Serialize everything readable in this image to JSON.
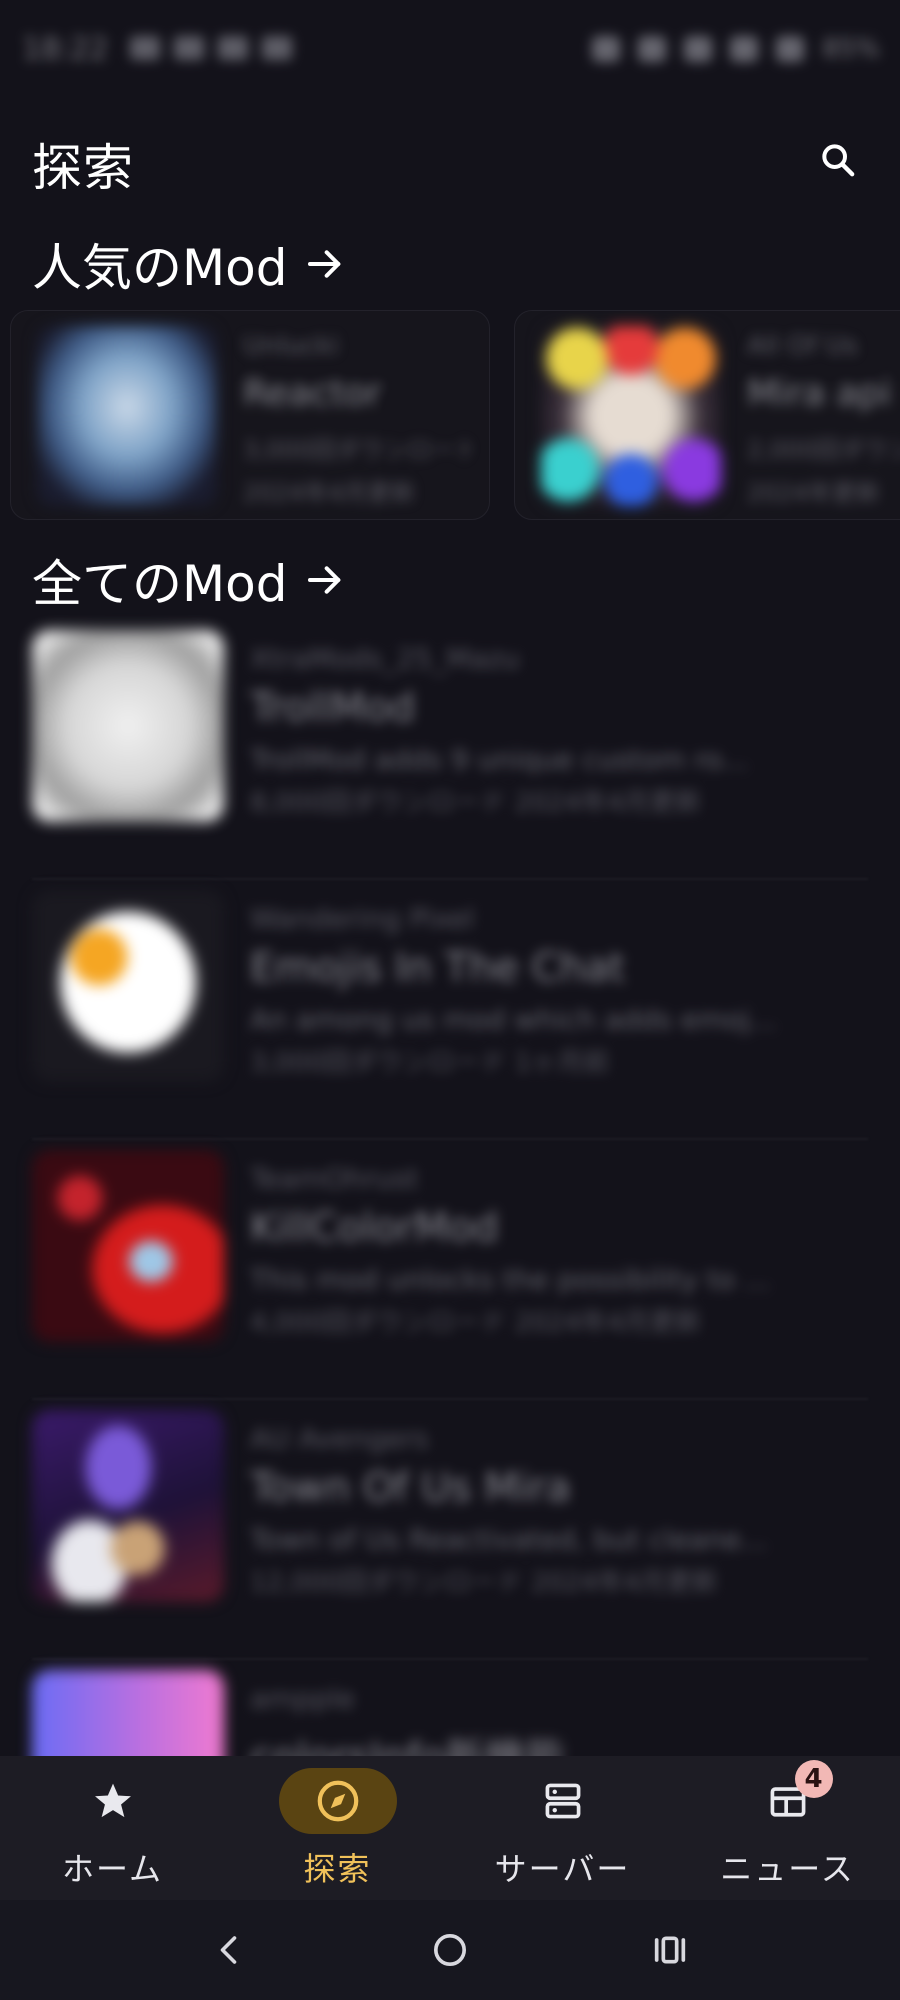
{
  "status_bar": {
    "time": "18:22",
    "battery": "85%"
  },
  "header": {
    "title": "探索"
  },
  "sections": {
    "popular": {
      "label": "人気のMod"
    },
    "all": {
      "label": "全てのMod"
    }
  },
  "popular_mods": [
    {
      "author": "Unlucki",
      "name": "Reactor",
      "downloads": "3,000回ダウンロード",
      "updated": "2024年4月更新"
    },
    {
      "author": "All Of Us",
      "name": "Mira api",
      "downloads": "2,000回ダウンロード",
      "updated": "2024年更新"
    }
  ],
  "all_mods": [
    {
      "author": "XtraMods_25_Mazu",
      "name": "TrollMod",
      "desc": "TrollMod adds 9 unique custom ro...",
      "meta": "8,000回ダウンロード  2024年4月更新"
    },
    {
      "author": "Wandering Pixel",
      "name": "Emojis In The Chat",
      "desc": "An among us mod which adds emoj...",
      "meta": "3,000回ダウンロード  1ヶ月前"
    },
    {
      "author": "TeamOhrust",
      "name": "KillColorMod",
      "desc": "This mod unlocks the possibility to ...",
      "meta": "4,000回ダウンロード  2024年4月更新"
    },
    {
      "author": "AU Avengers",
      "name": "Town Of Us Mira",
      "desc": "Town of Us Reactivated, but cleane...",
      "meta": "12,000回ダウンロード  2024年4月更新"
    },
    {
      "author": "ampple",
      "name": "colorsInfo新機能",
      "desc": "",
      "meta": ""
    }
  ],
  "bottom_nav": {
    "items": [
      {
        "label": "ホーム",
        "icon": "star-icon"
      },
      {
        "label": "探索",
        "icon": "compass-icon"
      },
      {
        "label": "サーバー",
        "icon": "server-icon"
      },
      {
        "label": "ニュース",
        "icon": "news-icon",
        "badge": "4"
      }
    ],
    "active_index": 1
  },
  "colors": {
    "background": "#13121a",
    "nav_background": "#1d1c24",
    "active_pill": "#5a4412",
    "active_label": "#f0c15a",
    "badge": "#f2b8b5"
  }
}
